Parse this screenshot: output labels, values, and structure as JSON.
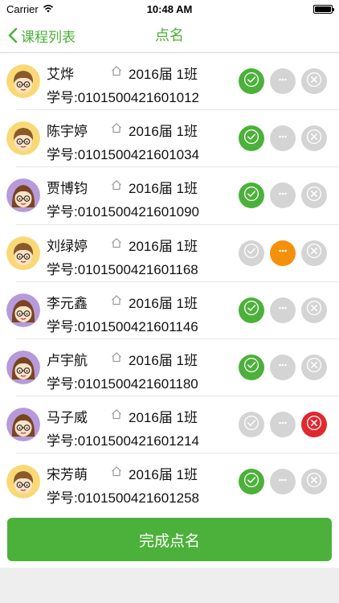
{
  "status_bar": {
    "carrier": "Carrier",
    "time": "10:48 AM"
  },
  "nav": {
    "back_label": "课程列表",
    "title": "点名"
  },
  "colors": {
    "accent": "#4cb13a",
    "leave": "#f4900c",
    "absent": "#e0282f",
    "inactive": "#d4d4d4"
  },
  "id_prefix": "学号:",
  "students": [
    {
      "name": "艾烨",
      "class": "2016届 1班",
      "id": "0101500421601012",
      "avatar": "boy-avatar",
      "status": "present"
    },
    {
      "name": "陈宇婷",
      "class": "2016届 1班",
      "id": "0101500421601034",
      "avatar": "boy-avatar",
      "status": "present"
    },
    {
      "name": "贾博钧",
      "class": "2016届 1班",
      "id": "0101500421601090",
      "avatar": "girl-avatar",
      "status": "present"
    },
    {
      "name": "刘绿婷",
      "class": "2016届 1班",
      "id": "0101500421601168",
      "avatar": "boy-avatar",
      "status": "leave"
    },
    {
      "name": "李元鑫",
      "class": "2016届 1班",
      "id": "0101500421601146",
      "avatar": "girl-avatar",
      "status": "present"
    },
    {
      "name": "卢宇航",
      "class": "2016届 1班",
      "id": "0101500421601180",
      "avatar": "girl-avatar",
      "status": "present"
    },
    {
      "name": "马子威",
      "class": "2016届 1班",
      "id": "0101500421601214",
      "avatar": "girl-avatar",
      "status": "absent"
    },
    {
      "name": "宋芳萌",
      "class": "2016届 1班",
      "id": "0101500421601258",
      "avatar": "boy-avatar",
      "status": "present"
    }
  ],
  "finish_button": "完成点名"
}
